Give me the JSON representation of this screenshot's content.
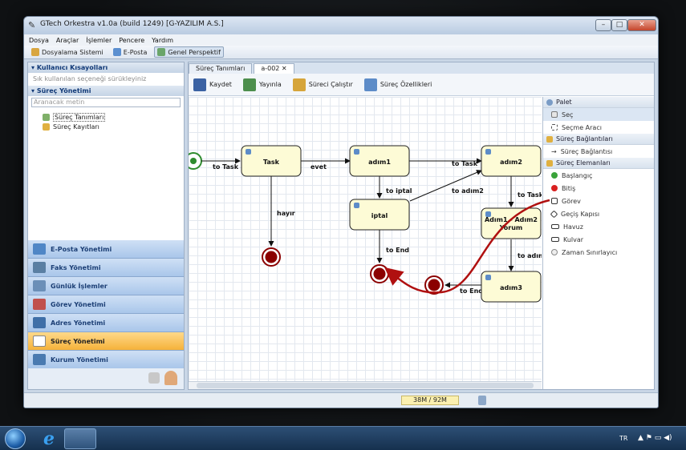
{
  "window": {
    "title": "GTech Orkestra v1.0a (build 1249) [G-YAZILIM A.S.]",
    "min": "–",
    "max": "□",
    "close": "✕"
  },
  "menu": [
    "Dosya",
    "Araçlar",
    "İşlemler",
    "Pencere",
    "Yardım"
  ],
  "toolbar": [
    "Dosyalama Sistemi",
    "E-Posta",
    "Genel Perspektif"
  ],
  "left": {
    "users_header": "Kullanıcı Kısayolları",
    "users_hint": "Sık kullanılan seçeneği sürükleyiniz",
    "process_header": "Süreç Yönetimi",
    "search_placeholder": "Aranacak metin",
    "tree": [
      "Süreç Tanımları",
      "Süreç Kayıtları"
    ],
    "nav": [
      "E-Posta Yönetimi",
      "Faks Yönetimi",
      "Günlük İşlemler",
      "Görev Yönetimi",
      "Adres Yönetimi",
      "Süreç Yönetimi",
      "Kurum Yönetimi"
    ]
  },
  "editor": {
    "tabs": [
      "Süreç Tanımları",
      "a-002"
    ],
    "buttons": [
      "Kaydet",
      "Yayınla",
      "Süreci Çalıştır",
      "Süreç Özellikleri"
    ]
  },
  "diagram": {
    "nodes": {
      "task": "Task",
      "adim1": "adım1",
      "adim2": "adım2",
      "iptal": "iptal",
      "yorum1": "Adım1 - Adım2",
      "yorum2": "Yorum",
      "adim3": "adım3"
    },
    "edges": {
      "to_task": "to Task",
      "evet": "evet",
      "to_task2": "to Task",
      "to_iptal": "to iptal",
      "to_adim2": "to adım2",
      "to_task3": "to Task",
      "hayir": "hayır",
      "to_end": "to End",
      "to_adim": "to adım",
      "to_end2": "to End"
    }
  },
  "palette": {
    "head": "Palet",
    "tools": [
      "Seç",
      "Seçme Aracı"
    ],
    "connections_head": "Süreç Bağlantıları",
    "connections": [
      "Süreç Bağlantısı"
    ],
    "elements_head": "Süreç Elemanları",
    "elements": [
      "Başlangıç",
      "Bitiş",
      "Görev",
      "Geçiş Kapısı",
      "Havuz",
      "Kulvar",
      "Zaman Sınırlayıcı"
    ]
  },
  "status": {
    "memory": "38M / 92M"
  },
  "taskbar": {
    "lang": "TR",
    "tray": "▲ ⚑ ▭ ◀)"
  },
  "colors": {
    "accent_nav": "#f5b23a",
    "end_event": "#8b0000",
    "arrow": "#b01010"
  }
}
